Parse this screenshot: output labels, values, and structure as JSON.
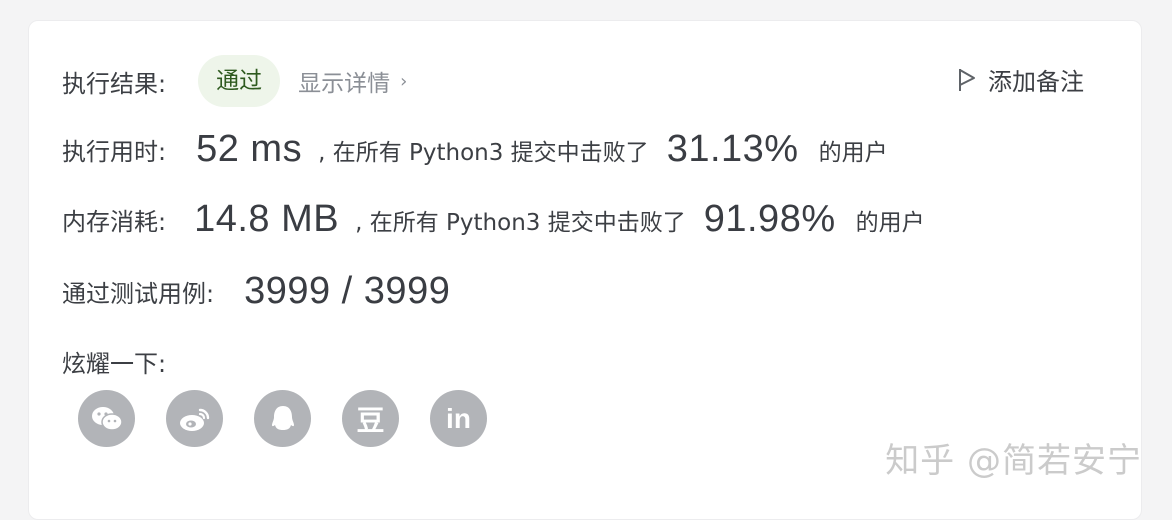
{
  "result": {
    "label": "执行结果:",
    "status": "通过",
    "detail_link": "显示详情",
    "chevron": "›",
    "note_button": "添加备注"
  },
  "runtime": {
    "label": "执行用时:",
    "value": "52 ms",
    "text_before": ", 在所有 Python3 提交中击败了",
    "percent": "31.13%",
    "text_after": "的用户"
  },
  "memory": {
    "label": "内存消耗:",
    "value": "14.8 MB",
    "text_before": ", 在所有 Python3 提交中击败了",
    "percent": "91.98%",
    "text_after": "的用户"
  },
  "tests": {
    "label": "通过测试用例:",
    "value": "3999 / 3999"
  },
  "share": {
    "label": "炫耀一下:",
    "icons": [
      "wechat-icon",
      "weibo-icon",
      "qq-icon",
      "douban-icon",
      "linkedin-icon"
    ],
    "douban_glyph": "豆",
    "linkedin_glyph": "in"
  },
  "watermark": "知乎 @简若安宁",
  "colors": {
    "pass_bg": "#eef5ea",
    "pass_text": "#2e5a1f",
    "icon_bg": "#b2b4b8"
  }
}
